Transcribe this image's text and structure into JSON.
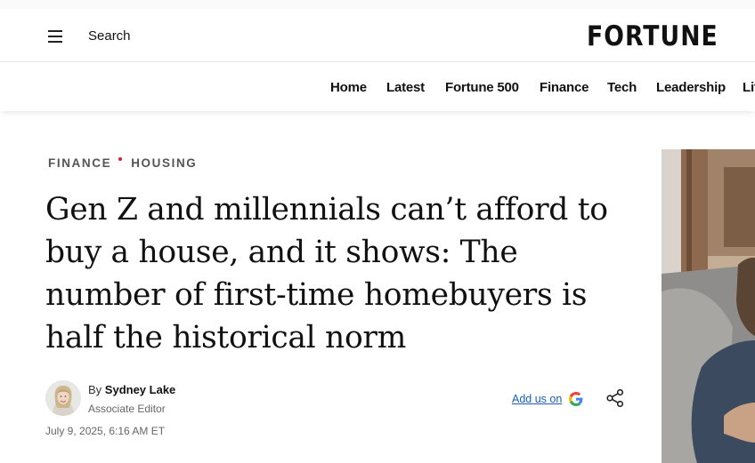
{
  "header": {
    "search_label": "Search",
    "logo_text": "FORTUNE"
  },
  "nav": {
    "items": [
      "Home",
      "Latest",
      "Fortune 500",
      "Finance",
      "Tech",
      "Leadership",
      "Lif"
    ]
  },
  "article": {
    "categories": [
      "FINANCE",
      "HOUSING"
    ],
    "headline": "Gen Z and millennials can’t afford to buy a house, and it shows: The number of first-time homebuyers is half the historical norm",
    "byline_prefix": "By",
    "author": "Sydney Lake",
    "author_title": "Associate Editor",
    "date": "July 9, 2025, 6:16 AM ET",
    "add_google_label": "Add us on"
  },
  "icons": {
    "menu": "hamburger-menu-icon",
    "google": "google-g-icon",
    "share": "share-icon"
  },
  "colors": {
    "category_dot": "#d81f26",
    "link": "#1a5fb4",
    "text": "#111111"
  }
}
